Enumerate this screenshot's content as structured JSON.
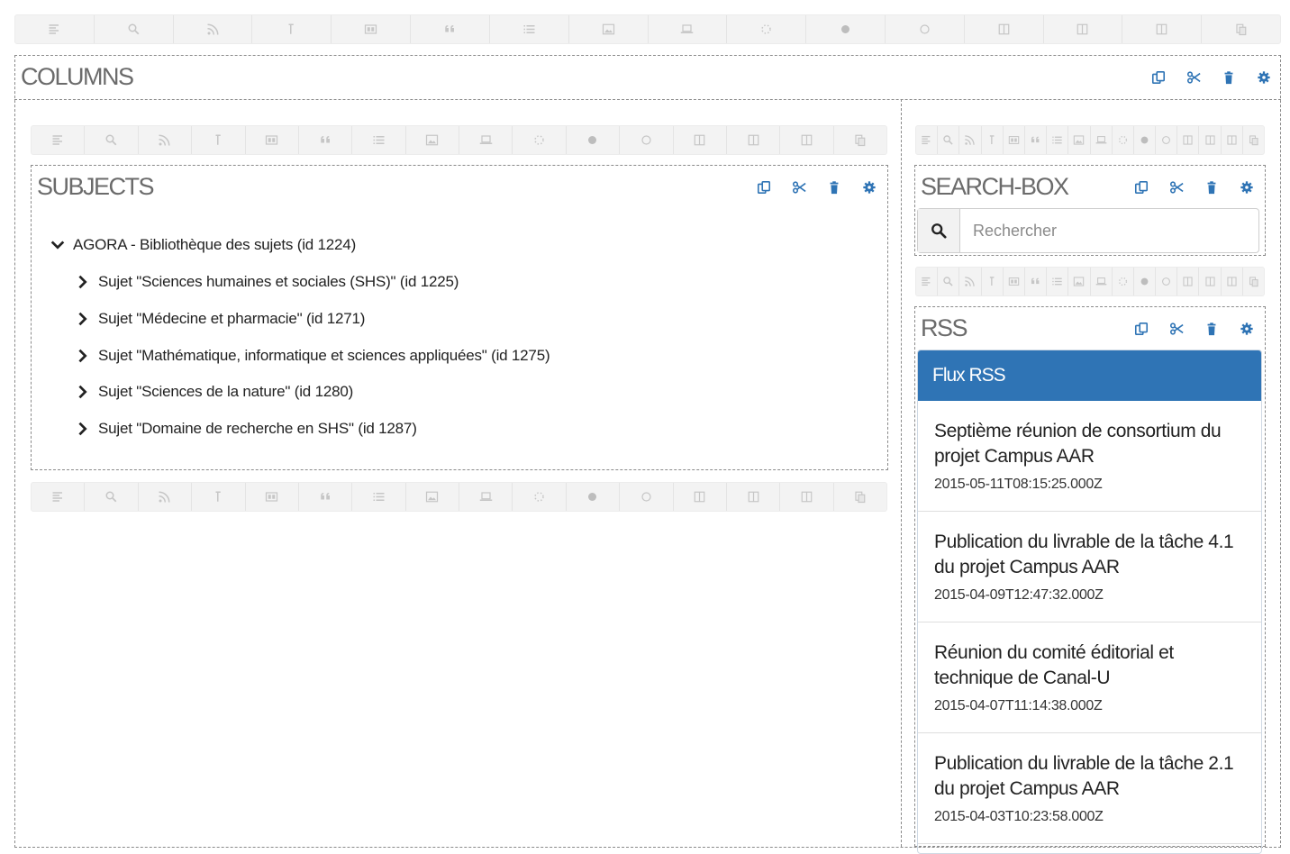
{
  "toolbar_icons": [
    "align-left-icon",
    "search-icon",
    "rss-icon",
    "text-cursor-icon",
    "html-block-icon",
    "quote-icon",
    "list-icon",
    "image-icon",
    "laptop-icon",
    "spinner-icon",
    "filled-circle-icon",
    "empty-circle-icon",
    "columns-icon",
    "columns-icon",
    "columns-icon",
    "paste-icon"
  ],
  "colors": {
    "accent": "#2f74b5",
    "icon_gray": "#c6c6c6",
    "action_blue": "#2f74b5"
  },
  "columns": {
    "title": "COLUMNS"
  },
  "subjects": {
    "title": "SUBJECTS",
    "tree": {
      "root": "AGORA - Bibliothèque des sujets (id 1224)",
      "children": [
        "Sujet \"Sciences humaines et sociales (SHS)\" (id 1225)",
        "Sujet \"Médecine et pharmacie\" (id 1271)",
        "Sujet \"Mathématique, informatique et sciences appliquées\" (id 1275)",
        "Sujet \"Sciences de la nature\" (id 1280)",
        "Sujet \"Domaine de recherche en SHS\" (id 1287)"
      ]
    }
  },
  "search_box": {
    "title": "SEARCH-BOX",
    "placeholder": "Rechercher"
  },
  "rss": {
    "title": "RSS",
    "heading": "Flux RSS",
    "items": [
      {
        "title": "Septième réunion de consortium du projet Campus AAR",
        "date": "2015-05-11T08:15:25.000Z"
      },
      {
        "title": "Publication du livrable de la tâche 4.1 du projet Campus AAR",
        "date": "2015-04-09T12:47:32.000Z"
      },
      {
        "title": "Réunion du comité éditorial et technique de Canal-U",
        "date": "2015-04-07T11:14:38.000Z"
      },
      {
        "title": "Publication du livrable de la tâche 2.1 du projet Campus AAR",
        "date": "2015-04-03T10:23:58.000Z"
      }
    ]
  }
}
